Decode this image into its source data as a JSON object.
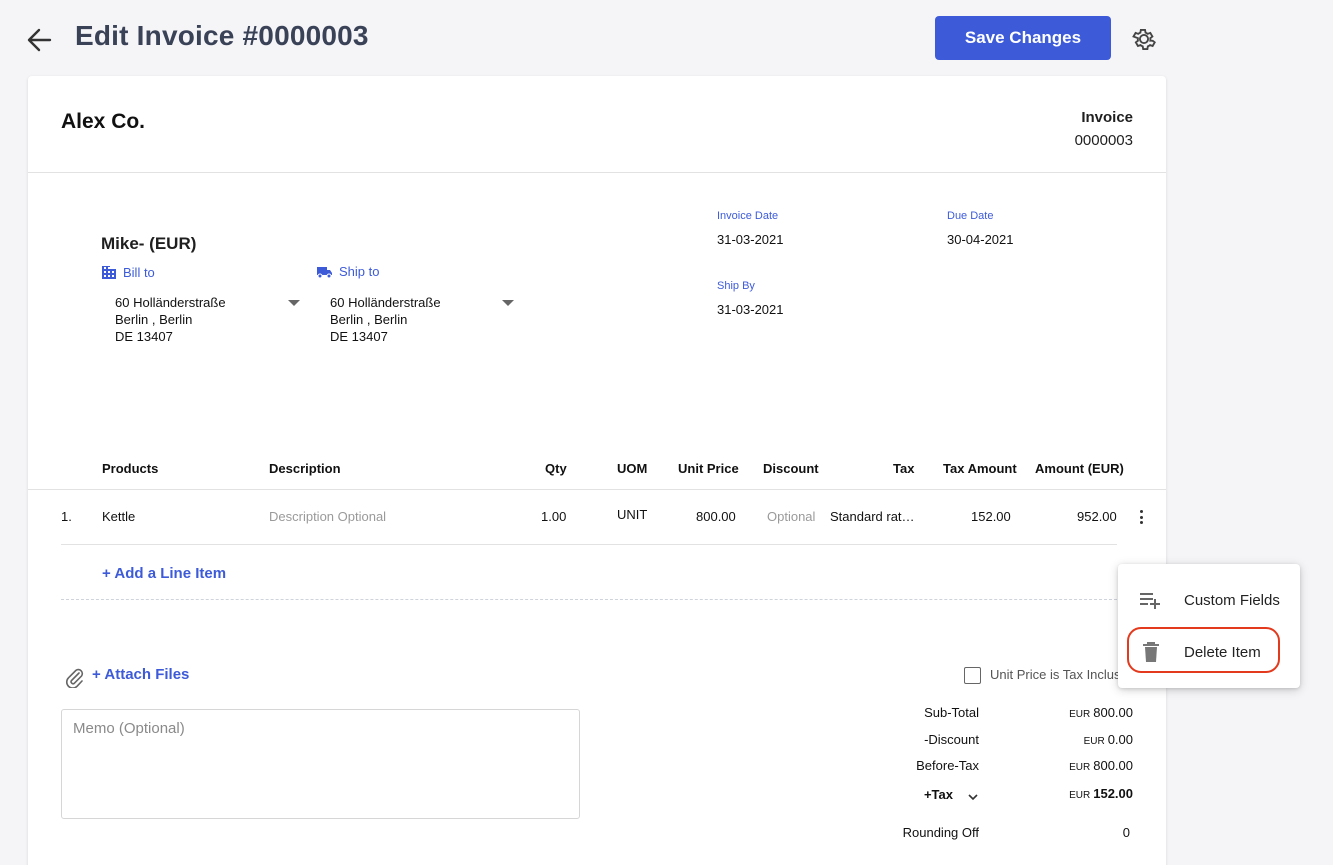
{
  "header": {
    "title": "Edit Invoice #0000003",
    "save_label": "Save Changes"
  },
  "invoice": {
    "company": "Alex Co.",
    "doc_type": "Invoice",
    "doc_number": "0000003",
    "customer": "Mike- (EUR)",
    "bill_to_label": "Bill to",
    "ship_to_label": "Ship to",
    "bill_to": [
      "60 Holländerstraße",
      "Berlin , Berlin",
      "DE 13407"
    ],
    "ship_to": [
      "60 Holländerstraße",
      "Berlin , Berlin",
      "DE 13407"
    ],
    "invoice_date_label": "Invoice Date",
    "invoice_date": "31-03-2021",
    "due_date_label": "Due Date",
    "due_date": "30-04-2021",
    "ship_by_label": "Ship By",
    "ship_by": "31-03-2021"
  },
  "table": {
    "headers": [
      "Products",
      "Description",
      "Qty",
      "UOM",
      "Unit Price",
      "Discount",
      "Tax",
      "Tax Amount",
      "Amount (EUR)"
    ],
    "rows": [
      {
        "index": "1.",
        "product": "Kettle",
        "description_placeholder": "Description Optional",
        "qty": "1.00",
        "uom": "UNIT",
        "unit_price": "800.00",
        "discount_placeholder": "Optional",
        "tax": "Standard rat…",
        "tax_amount": "152.00",
        "amount": "952.00"
      }
    ],
    "add_line_label": "+ Add a Line Item"
  },
  "footer": {
    "attach_label": "+ Attach Files",
    "memo_placeholder": "Memo (Optional)",
    "tax_inclusive_label": "Unit Price is Tax Inclusi",
    "totals": {
      "currency": "EUR",
      "subtotal_label": "Sub-Total",
      "subtotal": "800.00",
      "discount_label": "-Discount",
      "discount": "0.00",
      "before_tax_label": "Before-Tax",
      "before_tax": "800.00",
      "tax_label": "+Tax",
      "tax": "152.00",
      "rounding_label": "Rounding Off",
      "rounding": "0"
    }
  },
  "menu": {
    "custom_fields_label": "Custom Fields",
    "delete_item_label": "Delete Item"
  },
  "colors": {
    "accent": "#3d5bd9",
    "highlight": "#e33a1d"
  }
}
